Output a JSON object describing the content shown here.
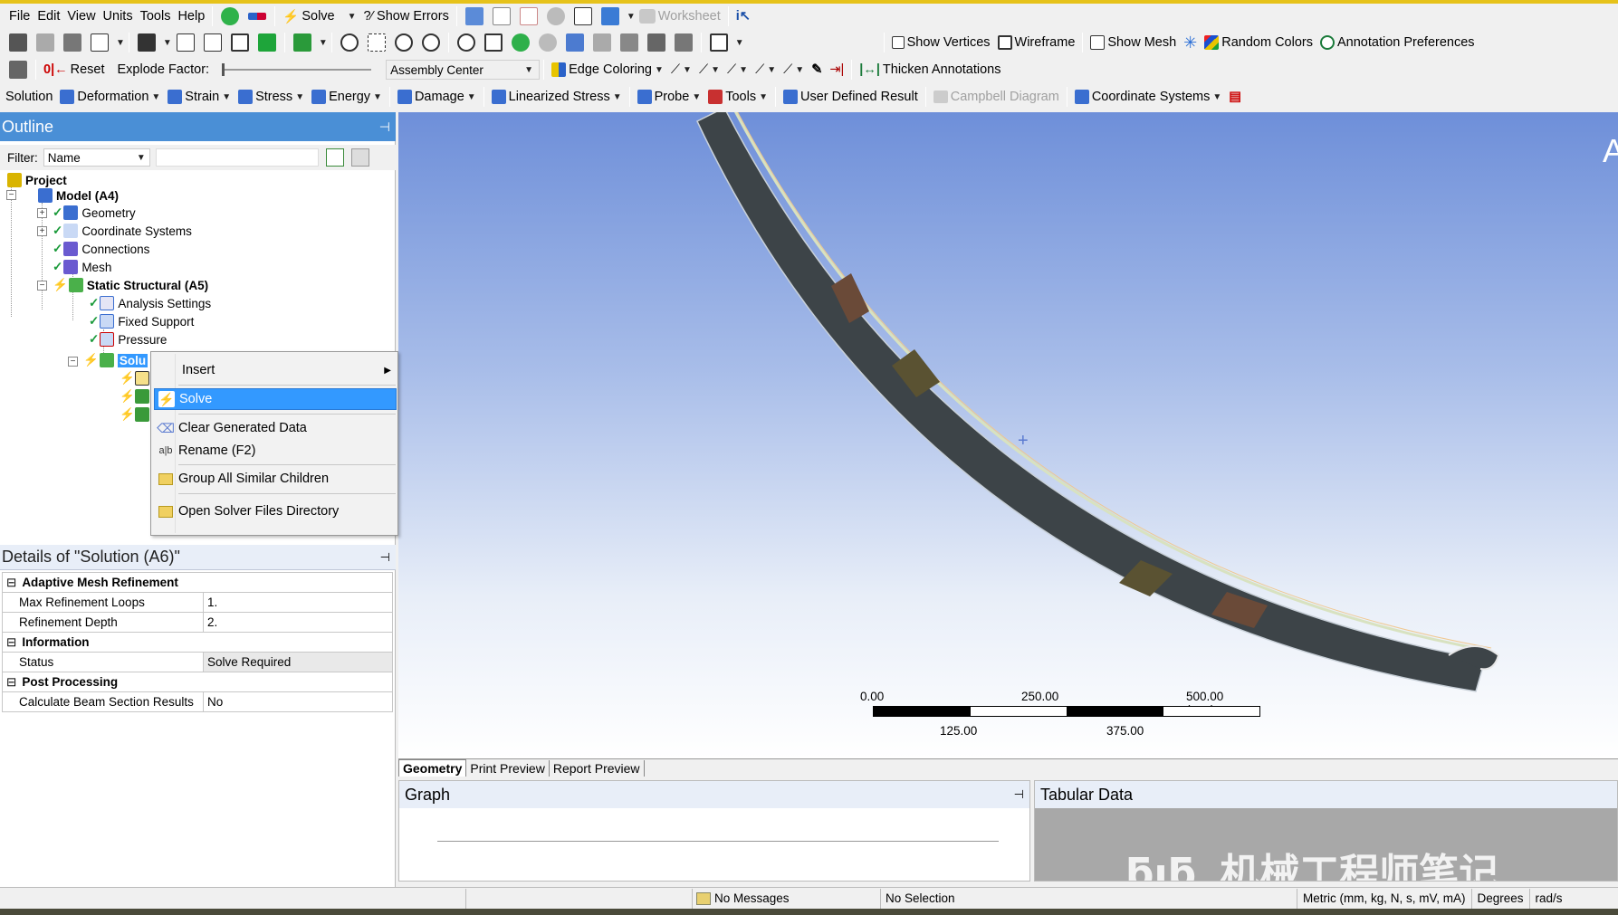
{
  "menubar": {
    "items": [
      "File",
      "Edit",
      "View",
      "Units",
      "Tools",
      "Help"
    ],
    "solve_label": "Solve",
    "show_errors_label": "?∕ Show Errors",
    "worksheet_label": "Worksheet"
  },
  "toolbar2": {
    "show_vertices": "Show Vertices",
    "wireframe": "Wireframe",
    "show_mesh": "Show Mesh",
    "random_colors": "Random Colors",
    "annotation_preferences": "Annotation Preferences"
  },
  "toolbar3": {
    "reset": "Reset",
    "explode_factor": "Explode Factor:",
    "assembly_center": "Assembly Center",
    "edge_coloring": "Edge Coloring",
    "thicken_annotations": "Thicken Annotations"
  },
  "toolbar4": {
    "solution": "Solution",
    "deformation": "Deformation",
    "strain": "Strain",
    "stress": "Stress",
    "energy": "Energy",
    "damage": "Damage",
    "linearized_stress": "Linearized Stress",
    "probe": "Probe",
    "tools": "Tools",
    "user_defined_result": "User Defined Result",
    "campbell_diagram": "Campbell Diagram",
    "coordinate_systems": "Coordinate Systems"
  },
  "outline": {
    "title": "Outline",
    "filter_label": "Filter:",
    "filter_value": "Name",
    "tree": {
      "project": "Project",
      "model": "Model (A4)",
      "geometry": "Geometry",
      "coordinate_systems": "Coordinate Systems",
      "connections": "Connections",
      "mesh": "Mesh",
      "static_structural": "Static Structural (A5)",
      "analysis_settings": "Analysis Settings",
      "fixed_support": "Fixed Support",
      "pressure": "Pressure",
      "solution_partial": "Solu"
    }
  },
  "context_menu": {
    "insert": "Insert",
    "solve": "Solve",
    "clear_generated_data": "Clear Generated Data",
    "rename": "Rename (F2)",
    "group_all_similar_children": "Group All Similar Children",
    "open_solver_files_directory": "Open Solver Files Directory"
  },
  "details": {
    "title": "Details of \"Solution (A6)\"",
    "groups": {
      "adaptive": "Adaptive Mesh Refinement",
      "information": "Information",
      "post": "Post Processing"
    },
    "rows": {
      "max_refinement_loops": {
        "label": "Max Refinement Loops",
        "value": "1."
      },
      "refinement_depth": {
        "label": "Refinement Depth",
        "value": "2."
      },
      "status": {
        "label": "Status",
        "value": "Solve Required"
      },
      "beam_section": {
        "label": "Calculate Beam Section Results",
        "value": "No"
      }
    }
  },
  "viewport": {
    "scale": {
      "top_labels": [
        "0.00",
        "250.00",
        "500.00 (mm)"
      ],
      "bottom_labels": [
        "125.00",
        "375.00"
      ]
    },
    "corner_letter": "A"
  },
  "tabs": {
    "geometry": "Geometry",
    "print_preview": "Print Preview",
    "report_preview": "Report Preview"
  },
  "graph_title": "Graph",
  "tabular_title": "Tabular Data",
  "statusbar": {
    "messages": "No Messages",
    "selection": "No Selection",
    "units": "Metric (mm, kg, N, s, mV, mA)",
    "degrees": "Degrees",
    "rads": "rad/s"
  },
  "watermark": "机械工程师笔记",
  "colors": {
    "title_blue": "#4a8fd6",
    "selection": "#3399ff",
    "viewport_top": "#6e8fd9",
    "viewport_bottom": "#ffffff"
  }
}
